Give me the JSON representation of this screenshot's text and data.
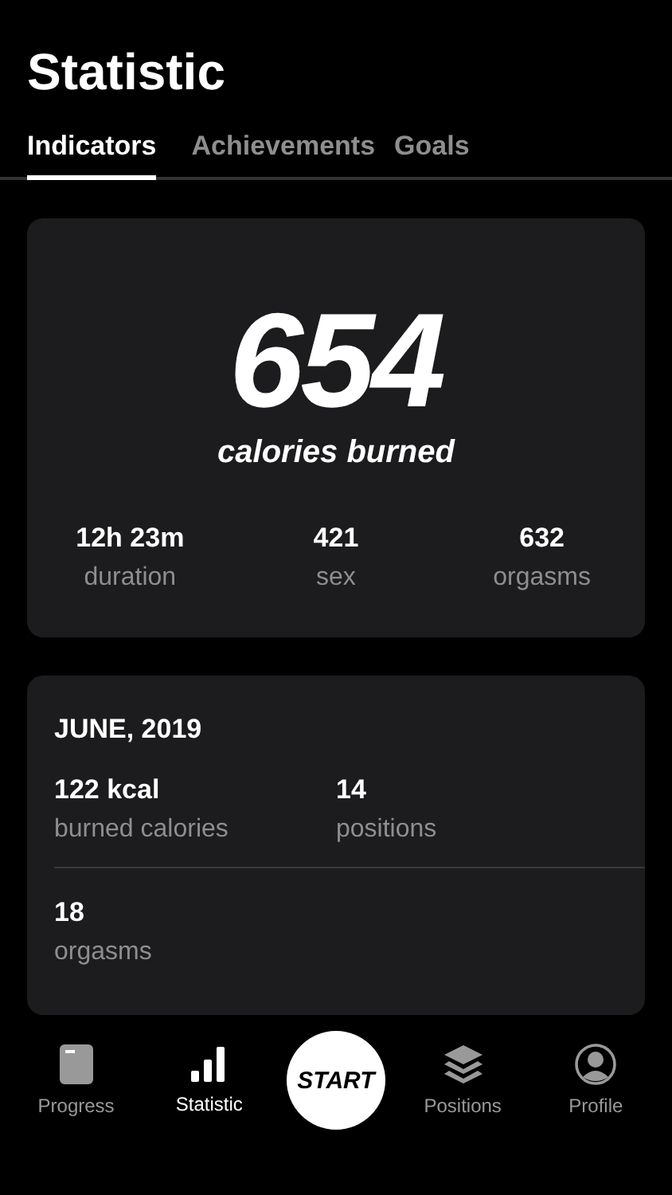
{
  "title": "Statistic",
  "tabs": [
    {
      "label": "Indicators",
      "selected": true
    },
    {
      "label": "Achievements",
      "selected": false
    },
    {
      "label": "Goals",
      "selected": false
    }
  ],
  "summary": {
    "value": "654",
    "caption": "calories burned",
    "stats": [
      {
        "value": "12h 23m",
        "label": "duration"
      },
      {
        "value": "421",
        "label": "sex"
      },
      {
        "value": "632",
        "label": "orgasms"
      }
    ]
  },
  "month": {
    "title": "JUNE, 2019",
    "rows": [
      [
        {
          "value": "122 kcal",
          "label": "burned calories"
        },
        {
          "value": "14",
          "label": "positions"
        }
      ],
      [
        {
          "value": "18",
          "label": "orgasms"
        }
      ]
    ]
  },
  "nav": [
    {
      "kind": "tab",
      "label": "Progress",
      "selected": false
    },
    {
      "kind": "tab",
      "label": "Statistic",
      "selected": true
    },
    {
      "kind": "start",
      "label": "START"
    },
    {
      "kind": "tab",
      "label": "Positions",
      "selected": false
    },
    {
      "kind": "tab",
      "label": "Profile",
      "selected": false
    }
  ]
}
